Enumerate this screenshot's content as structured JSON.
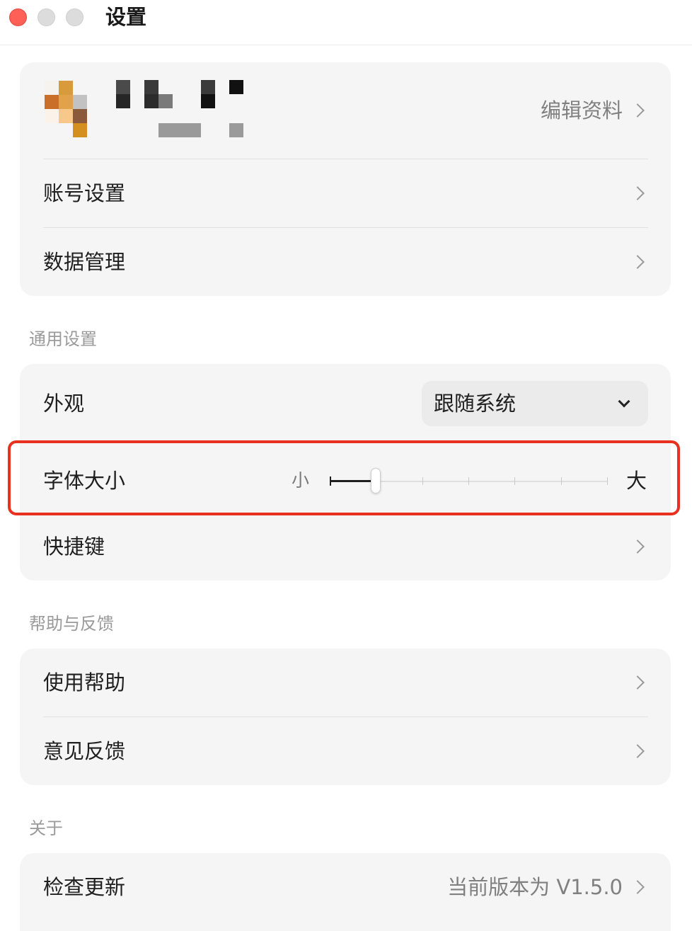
{
  "window": {
    "title": "设置"
  },
  "profile": {
    "edit_label": "编辑资料"
  },
  "account_card": {
    "items": [
      {
        "label": "账号设置"
      },
      {
        "label": "数据管理"
      }
    ]
  },
  "general": {
    "section_title": "通用设置",
    "appearance": {
      "label": "外观",
      "selected": "跟随系统"
    },
    "font_size": {
      "label": "字体大小",
      "min_label": "小",
      "max_label": "大",
      "steps": 7,
      "current_step": 2
    },
    "shortcuts": {
      "label": "快捷键"
    }
  },
  "help": {
    "section_title": "帮助与反馈",
    "items": [
      {
        "label": "使用帮助"
      },
      {
        "label": "意见反馈"
      }
    ]
  },
  "about": {
    "section_title": "关于",
    "check_update": {
      "label": "检查更新",
      "version_text": "当前版本为 V1.5.0"
    }
  },
  "colors": {
    "highlight": "#e8321f",
    "card_bg": "#f5f5f5",
    "traffic_close": "#fe5f57"
  }
}
